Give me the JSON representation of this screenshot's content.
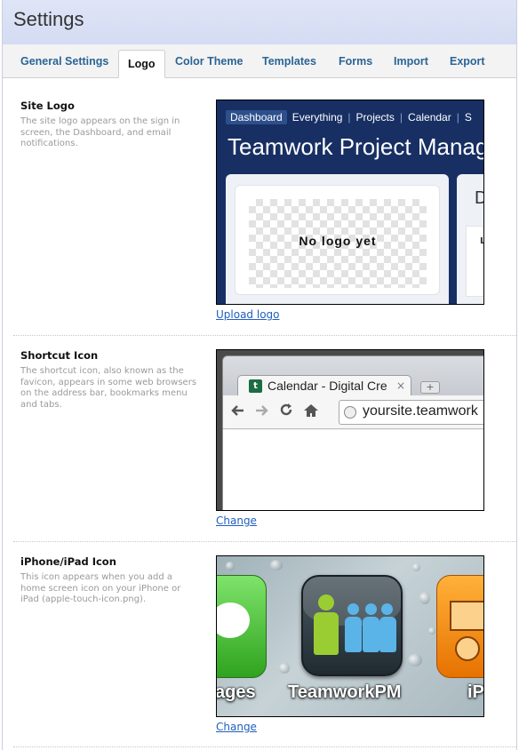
{
  "page": {
    "title": "Settings"
  },
  "tabs": [
    {
      "label": "General Settings",
      "active": false
    },
    {
      "label": "Logo",
      "active": true
    },
    {
      "label": "Color Theme",
      "active": false
    },
    {
      "label": "Templates",
      "active": false
    },
    {
      "label": "Forms",
      "active": false
    },
    {
      "label": "Import",
      "active": false
    },
    {
      "label": "Export",
      "active": false
    }
  ],
  "site_logo": {
    "title": "Site Logo",
    "description": "The site logo appears on the sign in screen, the Dashboard, and email notifications.",
    "action": "Upload logo",
    "preview": {
      "nav": [
        "Dashboard",
        "Everything",
        "Projects",
        "Calendar",
        "S"
      ],
      "brand": "Teamwork Project Manag",
      "placeholder": "No logo yet",
      "side_letter": "D",
      "side_small": "L"
    }
  },
  "shortcut_icon": {
    "title": "Shortcut Icon",
    "description": "The shortcut icon, also known as the favicon, appears in some web browsers on the address bar, bookmarks menu and tabs.",
    "action": "Change",
    "preview": {
      "favicon_letter": "t",
      "tab_title": "Calendar - Digital Cre",
      "tab_close": "×",
      "new_tab": "+",
      "url": "yoursite.teamwork",
      "icons": [
        "back-arrow-icon",
        "forward-arrow-icon",
        "reload-icon",
        "home-icon",
        "globe-icon"
      ]
    }
  },
  "iphone_icon": {
    "title": "iPhone/iPad Icon",
    "description": "This icon appears when you add a home screen icon on your iPhone or iPad (apple-touch-icon.png).",
    "action": "Change",
    "preview": {
      "labels": [
        "ages",
        "TeamworkPM",
        "iP"
      ],
      "colors": {
        "figure_green": "#9acd32",
        "figure_blue": "#5ab4e8"
      }
    }
  },
  "colors": {
    "header_bg": "#dfe5f7",
    "tab_text": "#2a6496",
    "link": "#1f5fbf",
    "logo_preview_bg": "#172f63"
  }
}
